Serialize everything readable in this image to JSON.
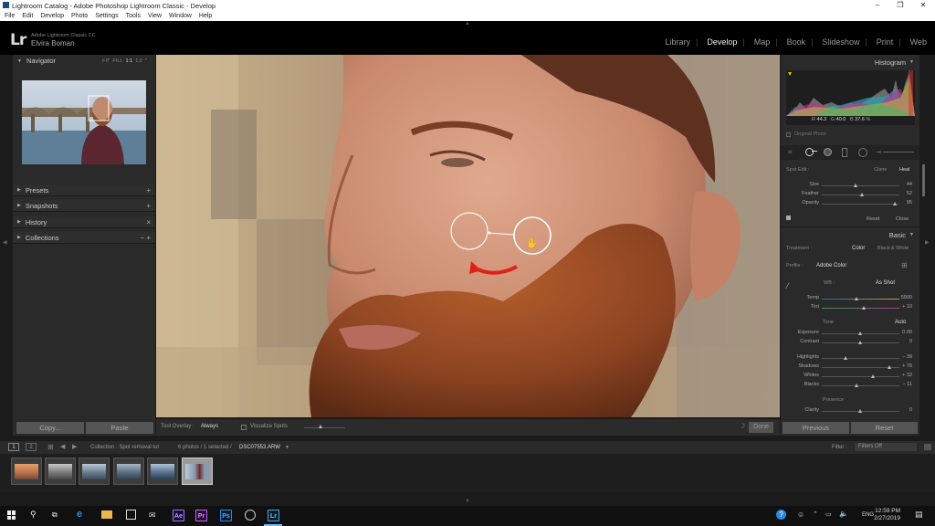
{
  "window": {
    "title": "Lightroom Catalog - Adobe Photoshop Lightroom Classic - Develop",
    "min_glyph": "–",
    "max_glyph": "❐",
    "close_glyph": "✕"
  },
  "menu": [
    "File",
    "Edit",
    "Develop",
    "Photo",
    "Settings",
    "Tools",
    "View",
    "Window",
    "Help"
  ],
  "identity": {
    "logo": "Lr",
    "product": "Adobe Lightroom Classic CC",
    "user": "Elvira Boman"
  },
  "modules": [
    "Library",
    "Develop",
    "Map",
    "Book",
    "Slideshow",
    "Print",
    "Web"
  ],
  "active_module": "Develop",
  "left": {
    "navigator": {
      "title": "Navigator",
      "options": [
        "FIT",
        "FILL",
        "1:1",
        "1:2"
      ],
      "zoom_glyph": "⌃"
    },
    "panels": [
      {
        "title": "Presets",
        "action": "+"
      },
      {
        "title": "Snapshots",
        "action": "+"
      },
      {
        "title": "History",
        "action": "×"
      },
      {
        "title": "Collections",
        "action": "−  +"
      }
    ],
    "copy_label": "Copy...",
    "paste_label": "Paste"
  },
  "toolbar": {
    "overlay_label": "Tool Overlay :",
    "overlay_value": "Always",
    "visualize_label": "Visualize Spots",
    "done_label": "Done"
  },
  "right": {
    "histogram": {
      "title": "Histogram",
      "r_label": "R",
      "r": "44.3",
      "g_label": "G",
      "g": "40.0",
      "b_label": "B",
      "b": "37.6",
      "pct": "%",
      "original_photo": "Original Photo"
    },
    "spot": {
      "title": "Spot Edit :",
      "clone": "Clone",
      "heal": "Heal",
      "sliders": [
        {
          "label": "Size",
          "value": "44",
          "pos": 0.44
        },
        {
          "label": "Feather",
          "value": "52",
          "pos": 0.52
        },
        {
          "label": "Opacity",
          "value": "95",
          "pos": 0.95
        }
      ],
      "reset": "Reset",
      "close": "Close"
    },
    "basic": {
      "title": "Basic",
      "treatment_label": "Treatment :",
      "color": "Color",
      "bw": "Black & White",
      "profile_label": "Profile :",
      "profile_value": "Adobe Color",
      "wb_label": "WB :",
      "wb_value": "As Shot",
      "temp": {
        "label": "Temp",
        "value": "5900",
        "pos": 0.45
      },
      "tint": {
        "label": "Tint",
        "value": "+ 10",
        "pos": 0.55
      },
      "tone_label": "Tone",
      "auto_label": "Auto",
      "sliders": [
        {
          "label": "Exposure",
          "value": "0.00",
          "pos": 0.5
        },
        {
          "label": "Contrast",
          "value": "0",
          "pos": 0.5
        }
      ],
      "sliders2": [
        {
          "label": "Highlights",
          "value": "− 39",
          "pos": 0.31
        },
        {
          "label": "Shadows",
          "value": "+ 76",
          "pos": 0.88
        },
        {
          "label": "Whites",
          "value": "+ 32",
          "pos": 0.66
        },
        {
          "label": "Blacks",
          "value": "− 11",
          "pos": 0.45
        }
      ],
      "presence_label": "Presence",
      "clarity": {
        "label": "Clarity",
        "value": "0",
        "pos": 0.5
      }
    },
    "previous_label": "Previous",
    "reset_label": "Reset"
  },
  "filmbar": {
    "view1": "1",
    "view2": "2",
    "collection": "Collection : Spot removal tut",
    "count": "6 photos / 1 selected /",
    "filename": "DSC07553.ARW",
    "filter_label": "Filter :",
    "filter_value": "Filters Off"
  },
  "taskbar": {
    "time": "12:59 PM",
    "date": "2/27/2019",
    "lang": "ENG",
    "apps": [
      "Ae",
      "Pr",
      "Ps",
      "Lr"
    ]
  },
  "colors": {
    "accent_red": "#e0201a",
    "panel_bg": "#2a2a2a",
    "ae": "#1c0a3a",
    "pr": "#2a0a3a",
    "ps": "#0a1a33",
    "lr": "#0a1e2c"
  }
}
